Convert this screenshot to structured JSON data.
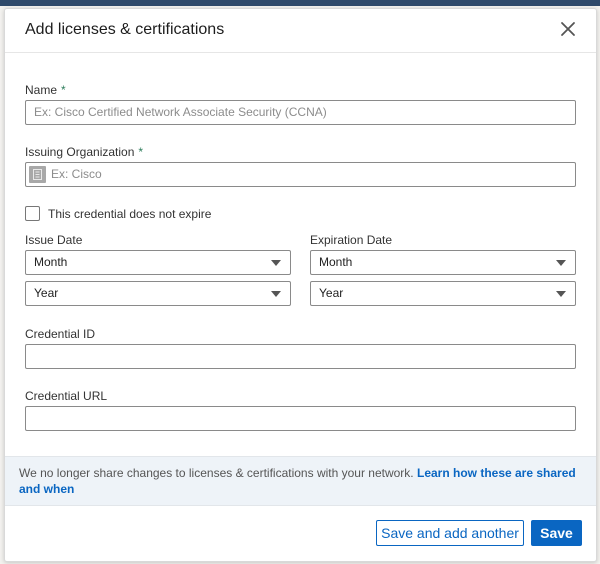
{
  "dialog": {
    "title": "Add licenses & certifications",
    "close_icon": "close-icon"
  },
  "form": {
    "name": {
      "label": "Name",
      "required": "*",
      "placeholder": "Ex: Cisco Certified Network Associate Security (CCNA)",
      "value": ""
    },
    "org": {
      "label": "Issuing Organization",
      "required": "*",
      "placeholder": "Ex: Cisco",
      "value": "",
      "icon": "company-logo-placeholder-icon"
    },
    "no_expire": {
      "label": "This credential does not expire",
      "checked": false
    },
    "issue_date": {
      "label": "Issue Date",
      "month": "Month",
      "year": "Year"
    },
    "expiration_date": {
      "label": "Expiration Date",
      "month": "Month",
      "year": "Year"
    },
    "credential_id": {
      "label": "Credential ID",
      "value": ""
    },
    "credential_url": {
      "label": "Credential URL",
      "value": ""
    }
  },
  "info": {
    "text": "We no longer share changes to licenses & certifications with your network.",
    "link": "Learn how these are shared and when"
  },
  "footer": {
    "save_add_label": "Save and add another",
    "save_label": "Save"
  },
  "colors": {
    "accent": "#0a66c2",
    "required": "#2e7d5b",
    "info_bg": "#eef3f8"
  }
}
